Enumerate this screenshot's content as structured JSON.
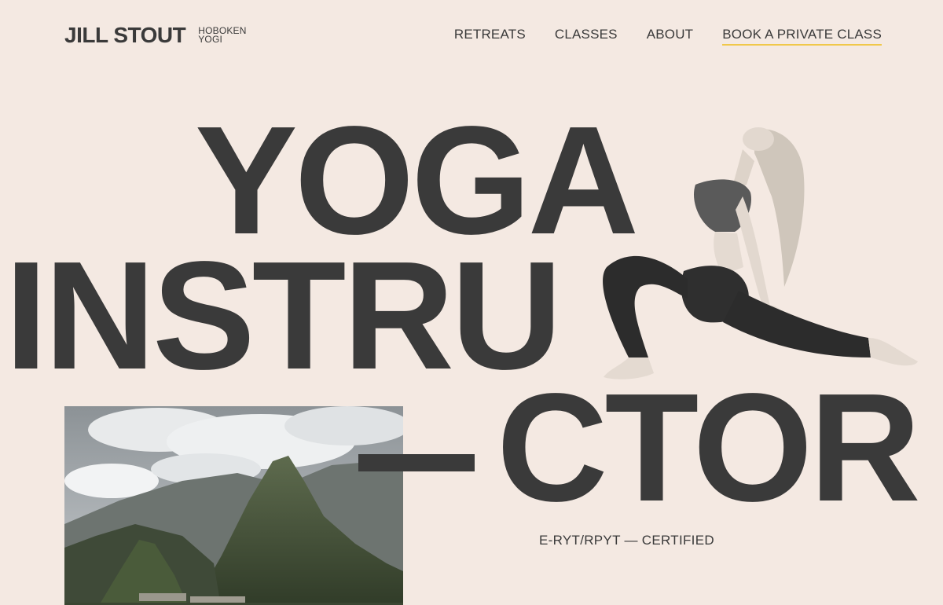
{
  "brand": {
    "name": "JILL STOUT",
    "tagline_line1": "HOBOKEN",
    "tagline_line2": "YOGI"
  },
  "nav": {
    "items": [
      {
        "label": "RETREATS"
      },
      {
        "label": "CLASSES"
      },
      {
        "label": "ABOUT"
      },
      {
        "label": "BOOK A PRIVATE CLASS"
      }
    ]
  },
  "hero": {
    "line1": "YOGA",
    "line2": "INSTRU",
    "line3": "CTOR",
    "certification": "E-RYT/RPYT — CERTIFIED"
  },
  "colors": {
    "background": "#f4e9e2",
    "text": "#3a3a3a",
    "cta_underline": "#f0c84a"
  },
  "images": {
    "landscape": "mountain-landscape-photo",
    "figure": "yoga-pose-photo"
  }
}
